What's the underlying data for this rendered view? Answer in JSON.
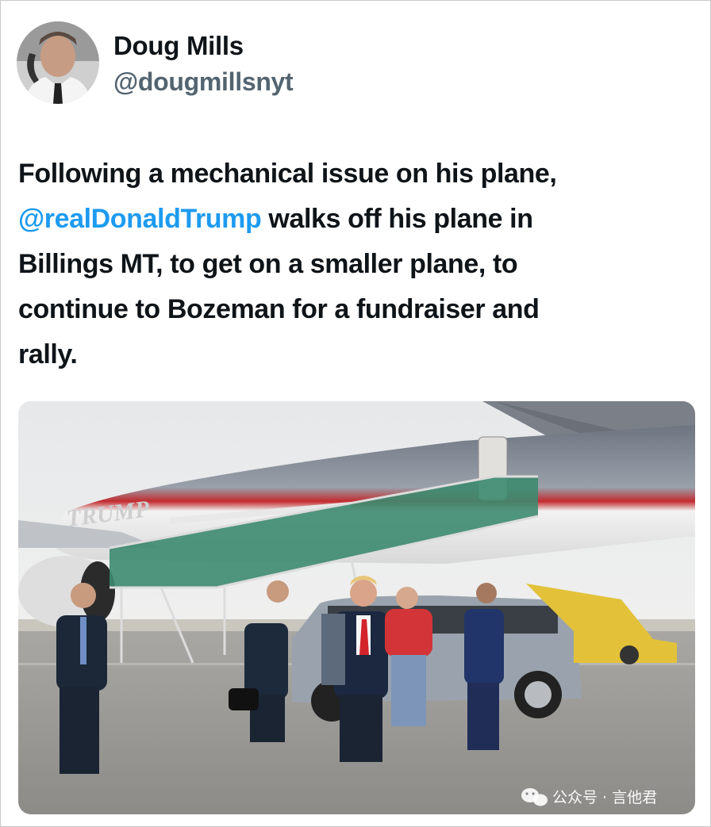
{
  "author": {
    "display_name": "Doug Mills",
    "handle": "@dougmillsnyt"
  },
  "tweet": {
    "line1": "Following a mechanical issue on his plane,",
    "mention": "@realDonaldTrump",
    "line2_rest": " walks off his plane in",
    "line3": "Billings MT, to get on a smaller plane, to",
    "line4": "continue to Bozeman for a fundraiser and",
    "line5": "rally."
  },
  "photo": {
    "plane_lettering": "TRUMP",
    "watermark_text": "公众号 · 言他君"
  },
  "colors": {
    "text": "#0f1419",
    "handle": "#536471",
    "mention": "#1d9bf0"
  }
}
